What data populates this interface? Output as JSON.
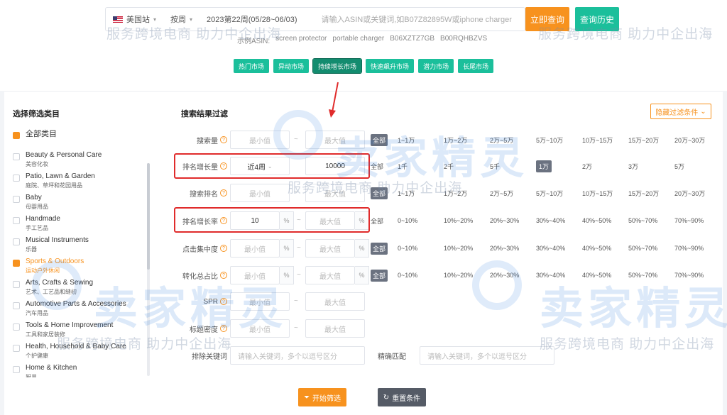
{
  "search": {
    "country": "美国站",
    "period_type": "按周",
    "week": "2023第22周(05/28~06/03)",
    "placeholder": "请输入ASIN或关键词,如B07Z82895W或iphone charger",
    "query_button": "立即查询",
    "history_button": "查询历史",
    "examples_label": "示例ASIN:",
    "examples": [
      "screen protector",
      "portable charger",
      "B06XZTZ7GB",
      "B00RQHBZVS"
    ]
  },
  "markets": [
    {
      "label": "热门市场",
      "active": false
    },
    {
      "label": "异动市场",
      "active": false
    },
    {
      "label": "持续增长市场",
      "active": true
    },
    {
      "label": "快速飙升市场",
      "active": false
    },
    {
      "label": "潜力市场",
      "active": false
    },
    {
      "label": "长尾市场",
      "active": false
    }
  ],
  "categories": {
    "title": "选择筛选类目",
    "items": [
      {
        "en": "全部类目",
        "zh": "",
        "checked": true,
        "selected": false
      },
      {
        "en": "Beauty & Personal Care",
        "zh": "美容化妆",
        "checked": false,
        "selected": false
      },
      {
        "en": "Patio, Lawn & Garden",
        "zh": "庭院、草坪和花园用品",
        "checked": false,
        "selected": false
      },
      {
        "en": "Baby",
        "zh": "母婴用品",
        "checked": false,
        "selected": false
      },
      {
        "en": "Handmade",
        "zh": "手工艺品",
        "checked": false,
        "selected": false
      },
      {
        "en": "Musical Instruments",
        "zh": "乐器",
        "checked": false,
        "selected": false
      },
      {
        "en": "Sports & Outdoors",
        "zh": "运动户外休闲",
        "checked": true,
        "selected": true
      },
      {
        "en": "Arts, Crafts & Sewing",
        "zh": "艺术、工艺品和缝纫",
        "checked": false,
        "selected": false
      },
      {
        "en": "Automotive Parts & Accessories",
        "zh": "汽车用品",
        "checked": false,
        "selected": false
      },
      {
        "en": "Tools & Home Improvement",
        "zh": "工具和家居装修",
        "checked": false,
        "selected": false
      },
      {
        "en": "Health, Household & Baby Care",
        "zh": "个护健康",
        "checked": false,
        "selected": false
      },
      {
        "en": "Home & Kitchen",
        "zh": "厨具",
        "checked": false,
        "selected": false
      }
    ]
  },
  "filters": {
    "title": "搜索结果过滤",
    "hide_button": "隐藏过滤条件",
    "min_placeholder": "最小值",
    "max_placeholder": "最大值",
    "keyword_placeholder": "请输入关键词，多个以逗号区分",
    "rows": {
      "search_volume": {
        "label": "搜索量",
        "min": "",
        "max": "",
        "options": [
          "全部",
          "1~1万",
          "1万~2万",
          "2万~5万",
          "5万~10万",
          "10万~15万",
          "15万~20万",
          "20万~30万"
        ]
      },
      "rank_growth": {
        "label": "排名增长量",
        "period": "近4周",
        "value": "10000",
        "options": [
          "全部",
          "1千",
          "2千",
          "5千",
          "1万",
          "2万",
          "3万",
          "5万"
        ]
      },
      "search_rank": {
        "label": "搜索排名",
        "options": [
          "全部",
          "1~1万",
          "1万~2万",
          "2万~5万",
          "5万~10万",
          "10万~15万",
          "15万~20万",
          "20万~30万"
        ]
      },
      "rank_growth_rate": {
        "label": "排名增长率",
        "min": "10",
        "options": [
          "全部",
          "0~10%",
          "10%~20%",
          "20%~30%",
          "30%~40%",
          "40%~50%",
          "50%~70%",
          "70%~90%"
        ]
      },
      "click_concentration": {
        "label": "点击集中度",
        "options": [
          "全部",
          "0~10%",
          "10%~20%",
          "20%~30%",
          "30%~40%",
          "40%~50%",
          "50%~70%",
          "70%~90%"
        ]
      },
      "conversion_share": {
        "label": "转化总占比",
        "options": [
          "全部",
          "0~10%",
          "10%~20%",
          "20%~30%",
          "30%~40%",
          "40%~50%",
          "50%~70%",
          "70%~90%"
        ]
      },
      "spr": {
        "label": "SPR"
      },
      "title_density": {
        "label": "标题密度"
      },
      "exclude_keywords": {
        "label": "排除关键词"
      },
      "exact_match": {
        "label": "精确匹配"
      }
    },
    "percent": "%",
    "dash": "~"
  },
  "actions": {
    "start": "开始筛选",
    "reset": "重置条件"
  },
  "watermark": {
    "text": "服务跨境电商 助力中企出海",
    "brand": "卖家精灵"
  },
  "colors": {
    "accent": "#f7921e",
    "teal": "#1bbf9b",
    "highlight_red": "#e02b2b"
  }
}
